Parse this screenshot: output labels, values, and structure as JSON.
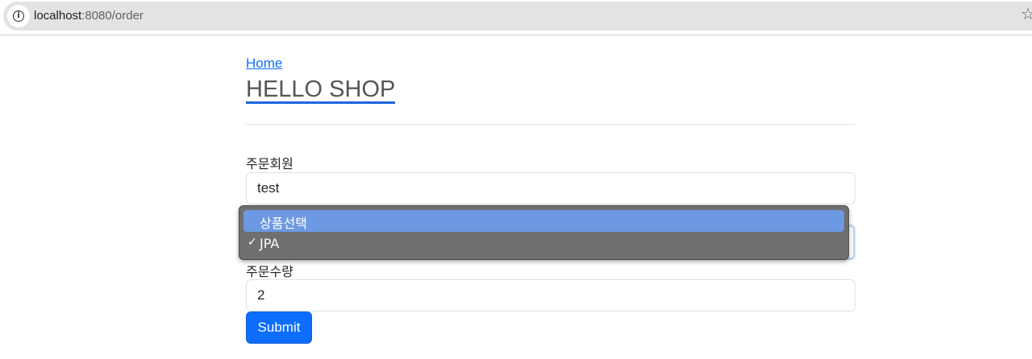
{
  "browser": {
    "url_host": "localhost",
    "url_path": ":8080/order",
    "info_icon": "info-icon",
    "star_icon": "star-icon",
    "star_glyph": "☆"
  },
  "header": {
    "home_link": "Home",
    "brand_title": "HELLO SHOP"
  },
  "form": {
    "member_label": "주문회원",
    "member_value": "test",
    "item_select": {
      "options": [
        {
          "label": "상품선택",
          "highlighted": true,
          "selected": false
        },
        {
          "label": "JPA",
          "highlighted": false,
          "selected": true
        }
      ],
      "check_glyph": "✓"
    },
    "count_label": "주문수량",
    "count_value": "2",
    "submit_label": "Submit"
  },
  "colors": {
    "primary": "#0d6efd",
    "dropdown_bg": "#6f6f6f",
    "dropdown_highlight": "#6d99e3"
  }
}
